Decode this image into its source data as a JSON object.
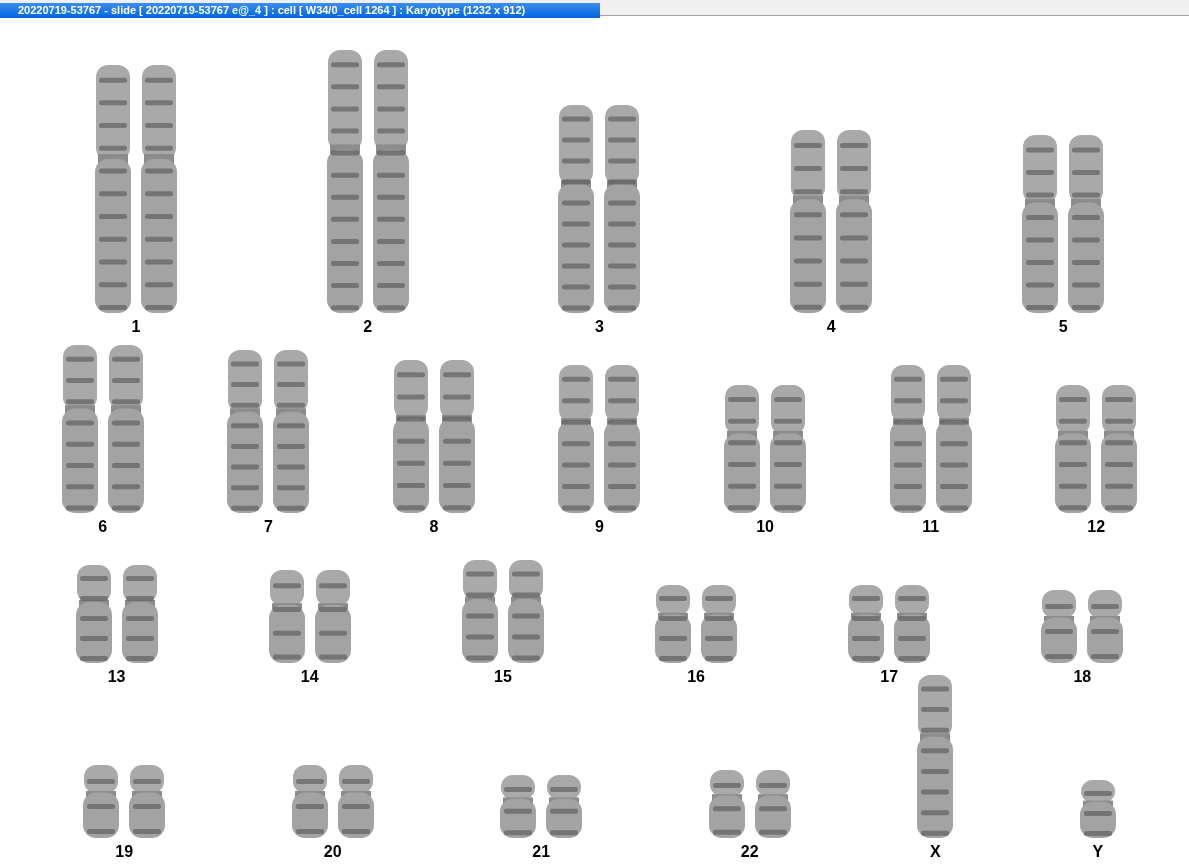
{
  "window": {
    "title": "20220719-53767 - slide [ 20220719-53767 e@_4 ] : cell [ W34/0_cell 1264 ] : Karyotype  (1232 x 912)"
  },
  "karyotype": {
    "chromosomes": [
      {
        "label": "1",
        "kind": "pair"
      },
      {
        "label": "2",
        "kind": "pair"
      },
      {
        "label": "3",
        "kind": "pair"
      },
      {
        "label": "4",
        "kind": "pair"
      },
      {
        "label": "5",
        "kind": "pair"
      },
      {
        "label": "6",
        "kind": "pair"
      },
      {
        "label": "7",
        "kind": "pair"
      },
      {
        "label": "8",
        "kind": "pair"
      },
      {
        "label": "9",
        "kind": "pair"
      },
      {
        "label": "10",
        "kind": "pair"
      },
      {
        "label": "11",
        "kind": "pair"
      },
      {
        "label": "12",
        "kind": "pair"
      },
      {
        "label": "13",
        "kind": "pair"
      },
      {
        "label": "14",
        "kind": "pair"
      },
      {
        "label": "15",
        "kind": "pair"
      },
      {
        "label": "16",
        "kind": "pair"
      },
      {
        "label": "17",
        "kind": "pair"
      },
      {
        "label": "18",
        "kind": "pair"
      },
      {
        "label": "19",
        "kind": "pair"
      },
      {
        "label": "20",
        "kind": "pair"
      },
      {
        "label": "21",
        "kind": "pair"
      },
      {
        "label": "22",
        "kind": "pair"
      },
      {
        "label": "X",
        "kind": "single"
      },
      {
        "label": "Y",
        "kind": "single"
      }
    ]
  }
}
